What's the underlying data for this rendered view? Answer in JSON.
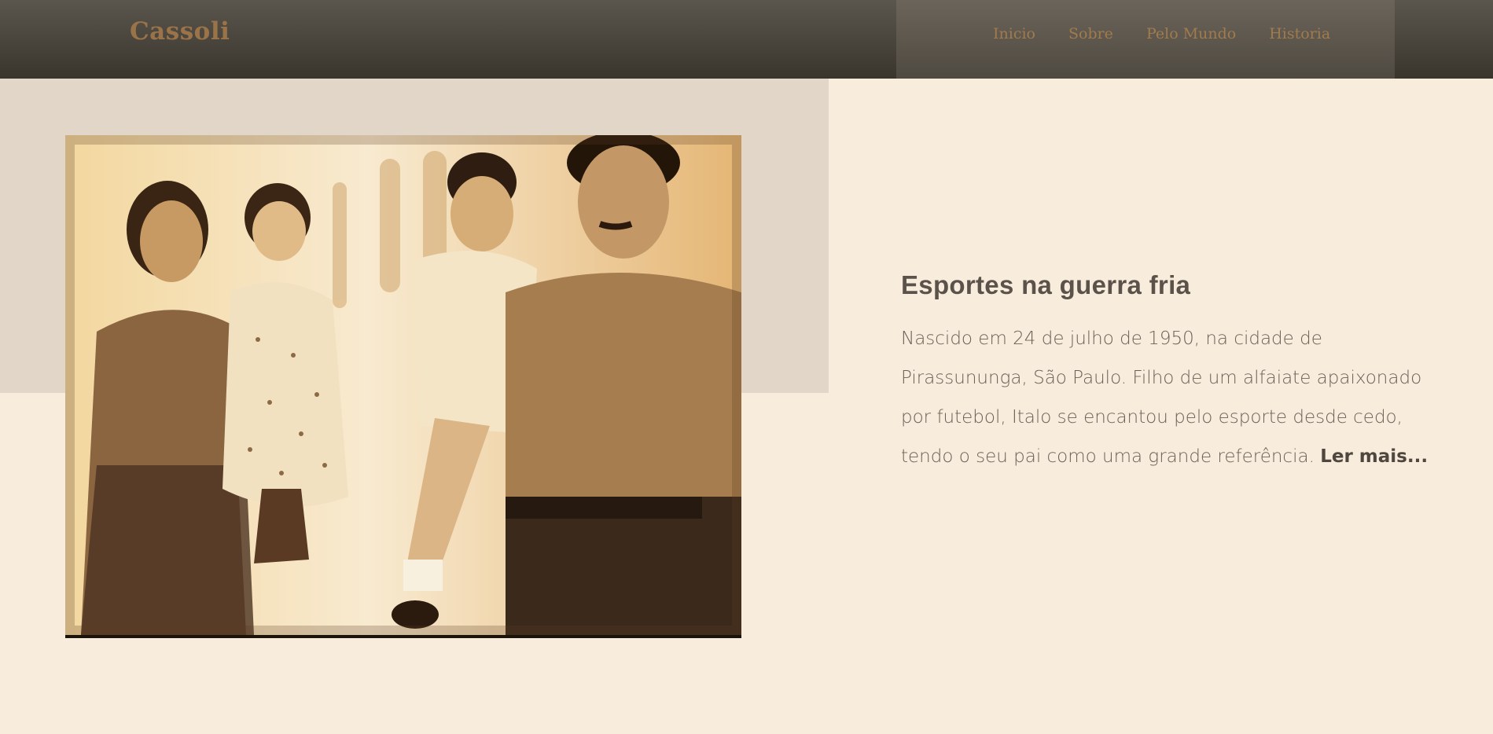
{
  "header": {
    "brand": "Cassoli",
    "nav": [
      {
        "label": "Inicio"
      },
      {
        "label": "Sobre"
      },
      {
        "label": "Pelo Mundo"
      },
      {
        "label": "Historia"
      }
    ]
  },
  "article": {
    "title": "Esportes na guerra fria",
    "body": "Nascido em 24 de julho de 1950, na cidade de Pirassununga, São Paulo. Filho de um alfaiate apaixonado por futebol, Italo se encantou pelo esporte desde cedo, tendo o seu pai como uma grande referência.",
    "read_more": "Ler mais..."
  },
  "colors": {
    "page_bg": "#f8ecdd",
    "header_bg": "#3f3b33",
    "nav_panel_bg": "#5a544b",
    "accent": "#9a7448",
    "block_bg": "#e2d6c8",
    "text": "#6b6157"
  }
}
